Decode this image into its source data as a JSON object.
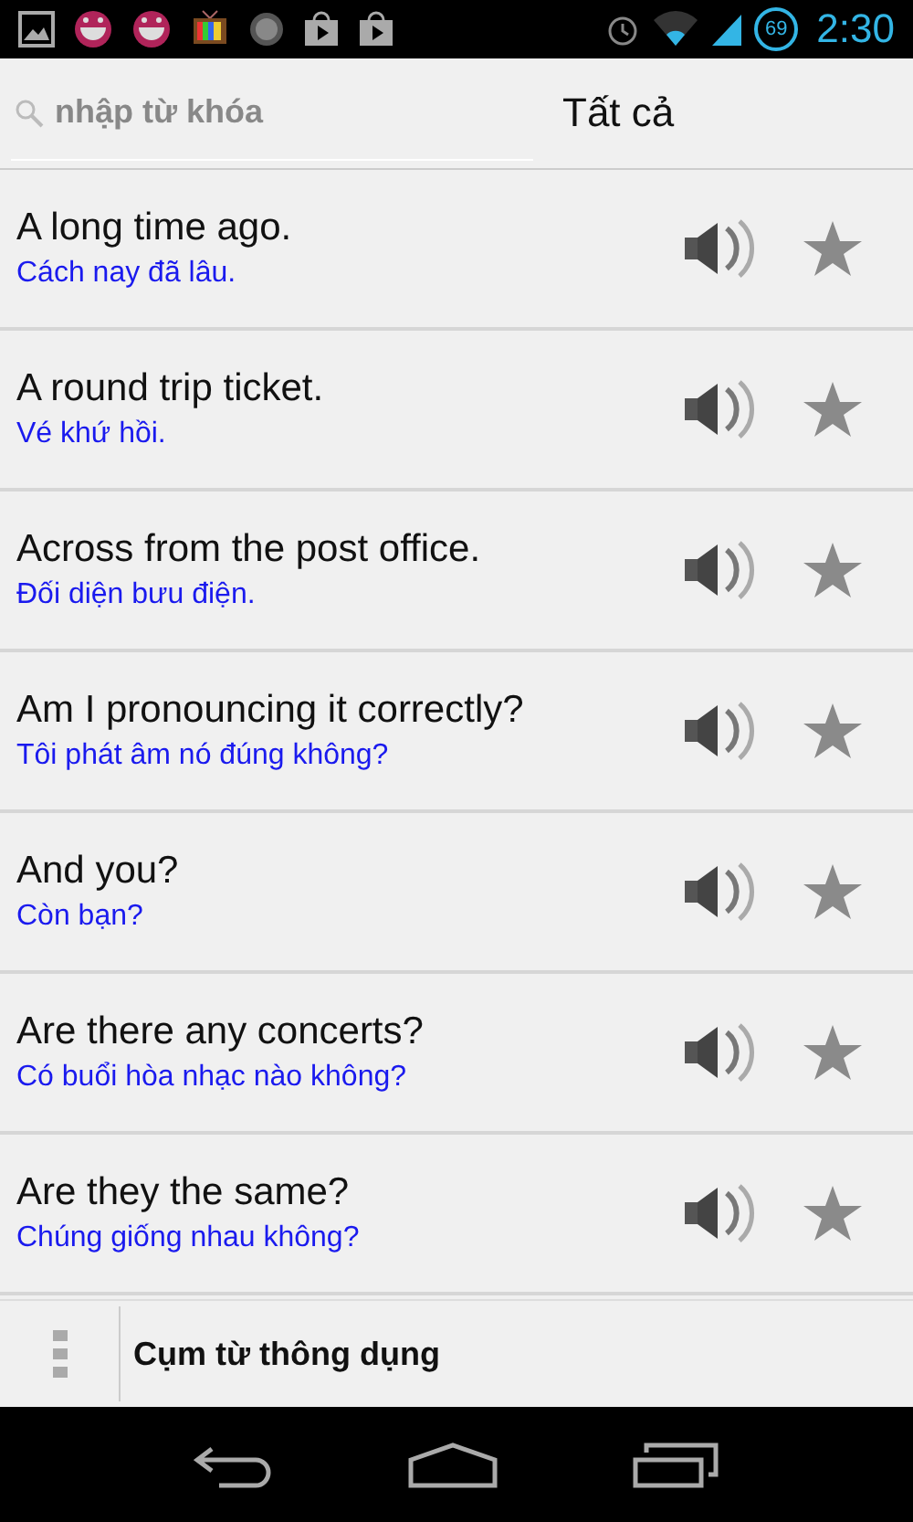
{
  "status_bar": {
    "battery": "69",
    "time": "2:30"
  },
  "header": {
    "search": {
      "placeholder": "nhập từ khóa"
    },
    "filter": "Tất cả"
  },
  "phrases": [
    {
      "english": "A long time ago.",
      "vietnamese": "Cách nay đã lâu.",
      "starred": false
    },
    {
      "english": "A round trip ticket.",
      "vietnamese": "Vé khứ hồi.",
      "starred": false
    },
    {
      "english": "Across from the post office.",
      "vietnamese": "Đối diện bưu điện.",
      "starred": false
    },
    {
      "english": "Am I pronouncing it correctly?",
      "vietnamese": "Tôi phát âm nó đúng không?",
      "starred": false
    },
    {
      "english": "And you?",
      "vietnamese": "Còn bạn?",
      "starred": false
    },
    {
      "english": "Are there any concerts?",
      "vietnamese": "Có buổi hòa nhạc nào không?",
      "starred": false
    },
    {
      "english": "Are they the same?",
      "vietnamese": "Chúng giống nhau không?",
      "starred": false
    }
  ],
  "bottom_bar": {
    "title": "Cụm từ thông dụng"
  }
}
